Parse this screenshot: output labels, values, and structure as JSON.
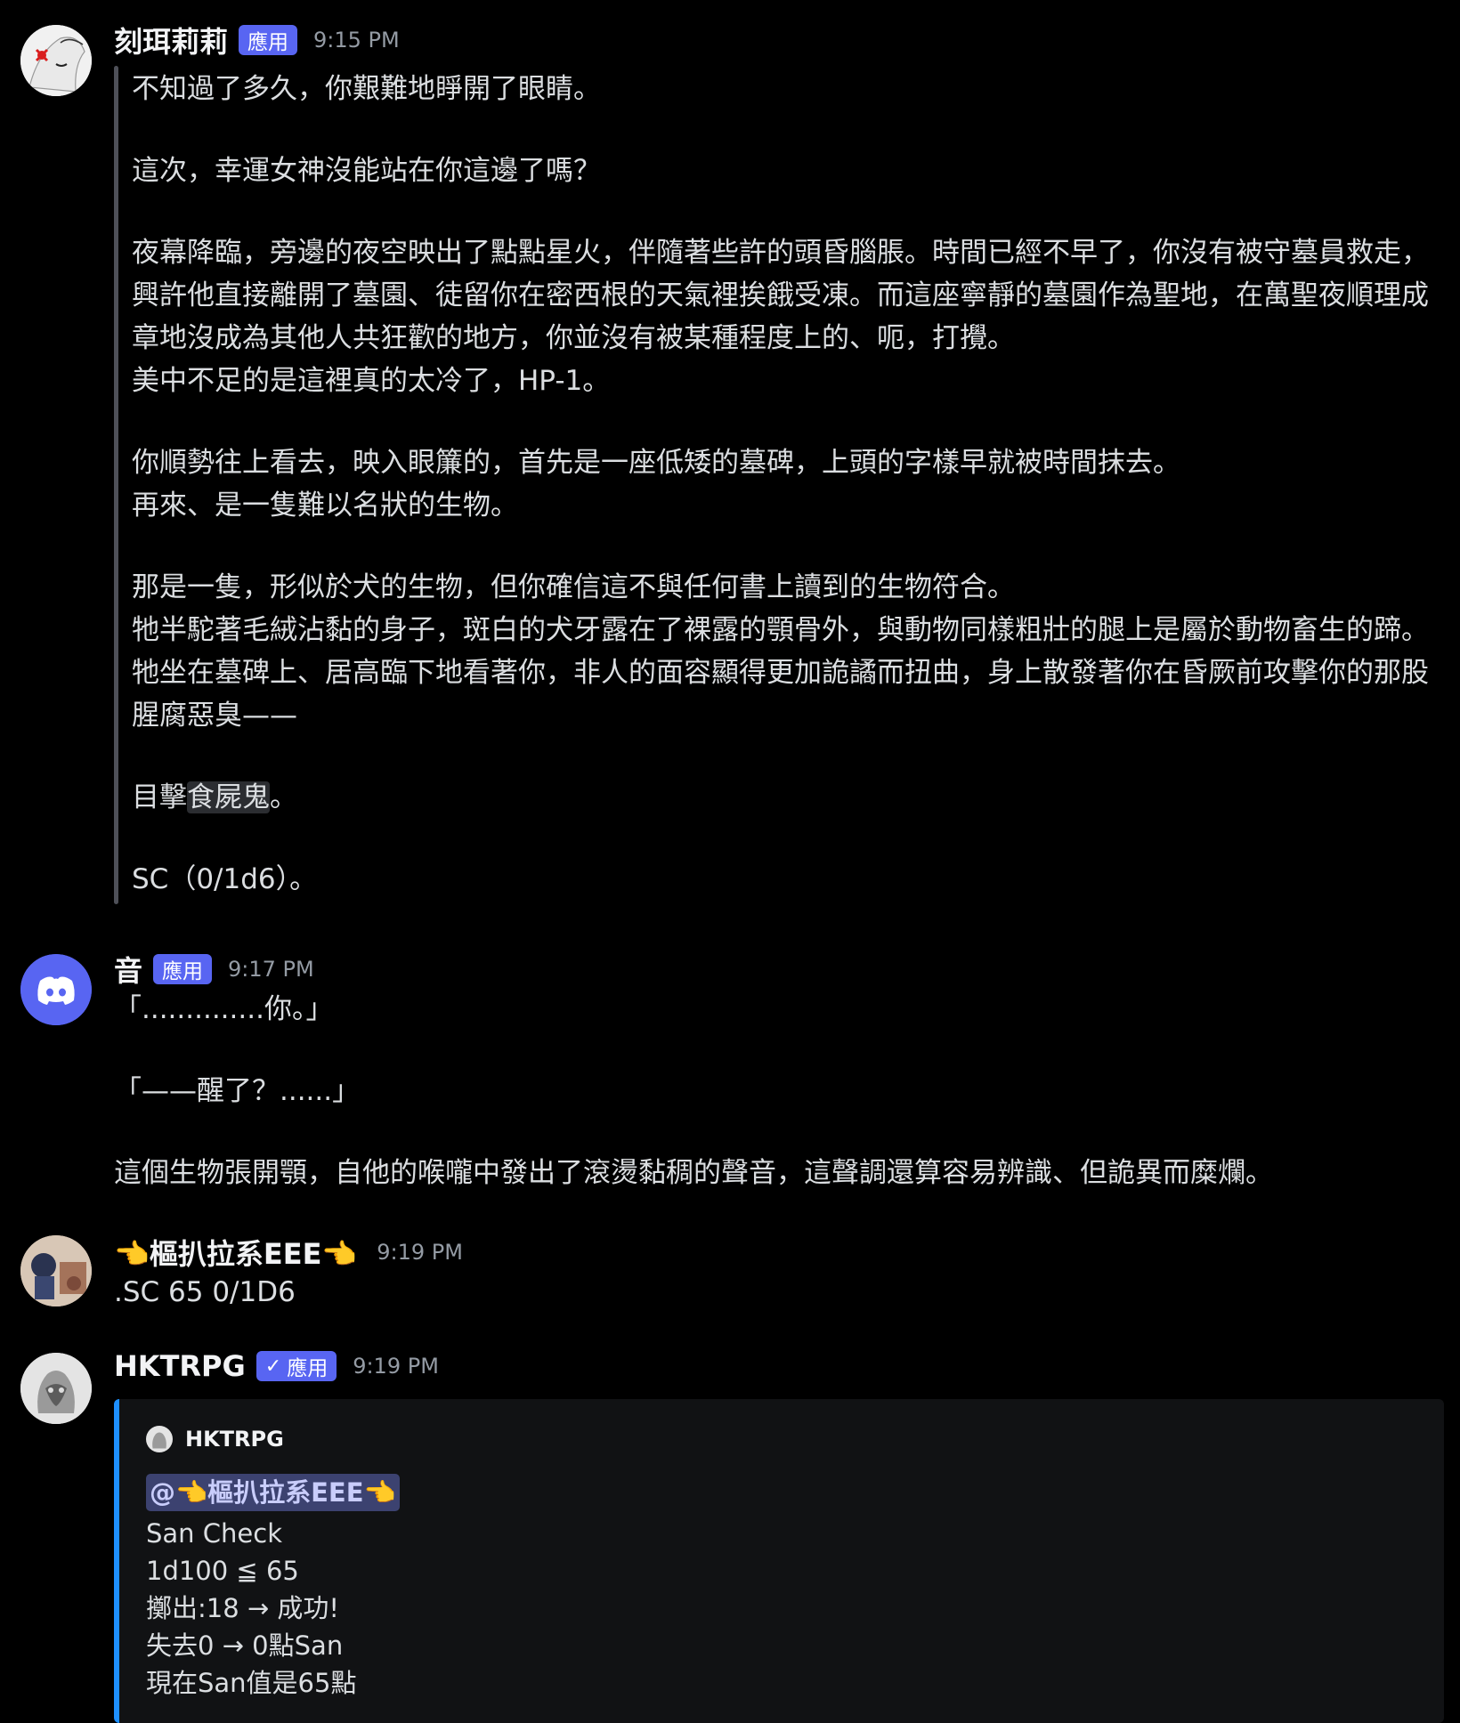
{
  "messages": [
    {
      "author": "刻珥莉莉",
      "badge": "應用",
      "time": "9:15 PM",
      "lines": [
        "不知過了多久，你艱難地睜開了眼睛。",
        "",
        "這次，幸運女神沒能站在你這邊了嗎？",
        "",
        "夜幕降臨，旁邊的夜空映出了點點星火，伴隨著些許的頭昏腦脹。時間已經不早了，你沒有被守墓員救走，興許他直接離開了墓園、徒留你在密西根的天氣裡挨餓受凍。而這座寧靜的墓園作為聖地，在萬聖夜順理成章地沒成為其他人共狂歡的地方，你並沒有被某種程度上的、呃，打攪。",
        "美中不足的是這裡真的太冷了，HP-1。",
        "",
        "你順勢往上看去，映入眼簾的，首先是一座低矮的墓碑，上頭的字樣早就被時間抹去。",
        "再來、是一隻難以名狀的生物。",
        "",
        "那是一隻，形似於犬的生物，但你確信這不與任何書上讀到的生物符合。",
        "牠半駝著毛絨沾黏的身子，斑白的犬牙露在了裸露的顎骨外，與動物同樣粗壯的腿上是屬於動物畜生的蹄。牠坐在墓碑上、居高臨下地看著你，非人的面容顯得更加詭譎而扭曲，身上散發著你在昏厥前攻擊你的那股腥腐惡臭——",
        "",
        "目擊",
        "",
        "SC（0/1d6）。"
      ],
      "highlight_word": "食屍鬼",
      "highlight_suffix": "。"
    },
    {
      "author": "音",
      "badge": "應用",
      "time": "9:17 PM",
      "lines": [
        "「..............你。」",
        "",
        "「——醒了？......」",
        "",
        "這個生物張開顎，自他的喉嚨中發出了滾燙黏稠的聲音，這聲調還算容易辨識、但詭異而糜爛。"
      ]
    },
    {
      "author": "👈樞扒拉系EEE👈",
      "time": "9:19 PM",
      "lines": [
        ".SC 65 0/1D6"
      ]
    },
    {
      "author": "HKTRPG",
      "badge": "應用",
      "time": "9:19 PM",
      "embed": {
        "author": "HKTRPG",
        "mention": "@👈樞扒拉系EEE👈",
        "lines": [
          "San Check",
          "1d100 ≦ 65",
          "擲出:18 → 成功!",
          "失去0 → 0點San",
          "現在San值是65點"
        ]
      }
    }
  ],
  "colors": {
    "accent": "#5865f2",
    "embed_bar": "#1e90ff",
    "background": "#000000"
  },
  "icons": [
    "discord-logo-icon",
    "check-icon"
  ]
}
